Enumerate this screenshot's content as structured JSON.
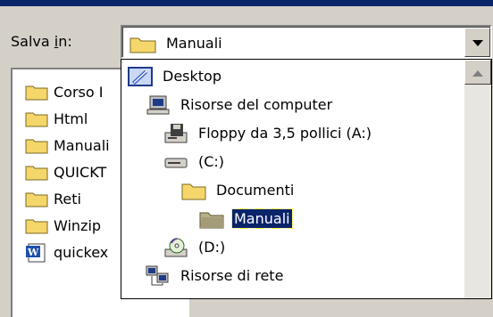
{
  "dialog": {
    "save_in_label_prefix": "Salva ",
    "save_in_label_hotkey": "i",
    "save_in_label_suffix": "n:"
  },
  "combo": {
    "selected": "Manuali"
  },
  "file_list": [
    {
      "label": "Corso I",
      "icon": "folder-icon"
    },
    {
      "label": "Html",
      "icon": "folder-icon"
    },
    {
      "label": "Manuali",
      "icon": "folder-icon"
    },
    {
      "label": "QUICKT",
      "icon": "folder-icon"
    },
    {
      "label": "Reti",
      "icon": "folder-icon"
    },
    {
      "label": "Winzip",
      "icon": "folder-icon"
    },
    {
      "label": "quickex",
      "icon": "word-document-icon"
    }
  ],
  "dropdown": {
    "items": [
      {
        "label": "Desktop",
        "icon": "desktop-icon"
      },
      {
        "label": "Risorse del computer",
        "icon": "my-computer-icon"
      },
      {
        "label": "Floppy da 3,5 pollici (A:)",
        "icon": "floppy-drive-icon"
      },
      {
        "label": "(C:)",
        "icon": "hard-drive-icon"
      },
      {
        "label": "Documenti",
        "icon": "folder-icon"
      },
      {
        "label": "Manuali",
        "icon": "folder-open-icon",
        "selected": true
      },
      {
        "label": "(D:)",
        "icon": "cd-drive-icon"
      },
      {
        "label": "Risorse di rete",
        "icon": "network-icon"
      }
    ]
  },
  "colors": {
    "face": "#d4d0c8",
    "selection": "#0a246a",
    "folder": "#f5d66b"
  }
}
